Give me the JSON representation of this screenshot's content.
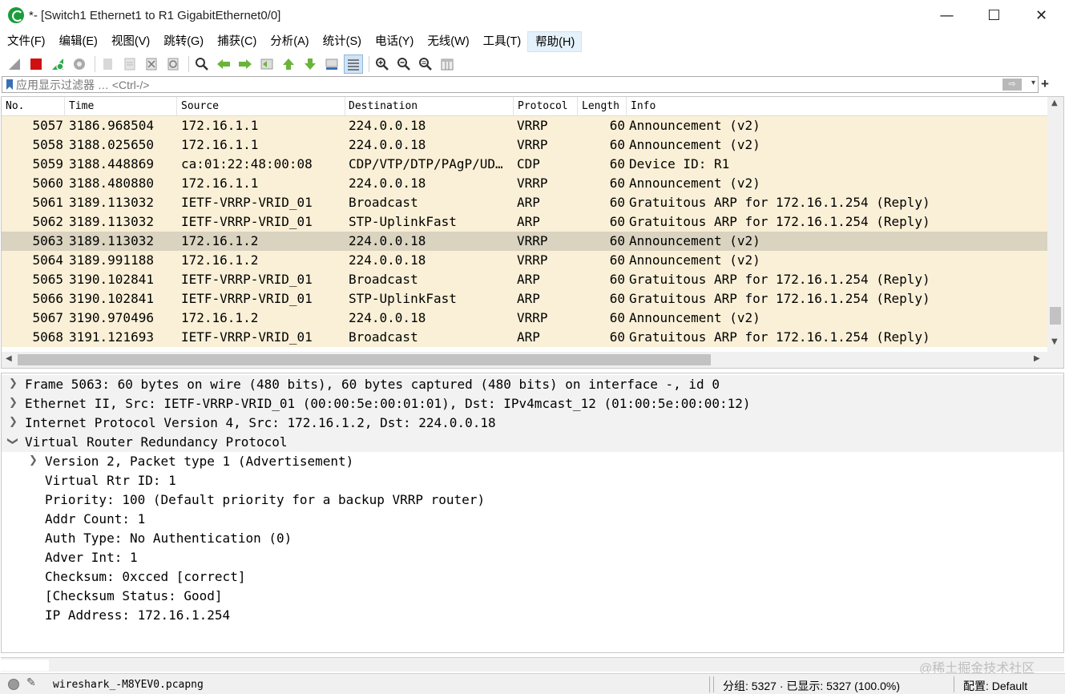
{
  "window": {
    "title": "*- [Switch1 Ethernet1 to R1 GigabitEthernet0/0]",
    "minimize": "—",
    "maximize": "☐",
    "close": "✕"
  },
  "menu": [
    "文件(F)",
    "编辑(E)",
    "视图(V)",
    "跳转(G)",
    "捕获(C)",
    "分析(A)",
    "统计(S)",
    "电话(Y)",
    "无线(W)",
    "工具(T)",
    "帮助(H)"
  ],
  "filter": {
    "placeholder": "应用显示过滤器 … <Ctrl-/>",
    "apply": "⇨",
    "dropdown": "▾",
    "add": "+"
  },
  "packet_list": {
    "columns": [
      "No.",
      "Time",
      "Source",
      "Destination",
      "Protocol",
      "Length",
      "Info"
    ],
    "rows": [
      [
        "5057",
        "3186.968504",
        "172.16.1.1",
        "224.0.0.18",
        "VRRP",
        "60",
        "Announcement (v2)"
      ],
      [
        "5058",
        "3188.025650",
        "172.16.1.1",
        "224.0.0.18",
        "VRRP",
        "60",
        "Announcement (v2)"
      ],
      [
        "5059",
        "3188.448869",
        "ca:01:22:48:00:08",
        "CDP/VTP/DTP/PAgP/UD…",
        "CDP",
        "60",
        "Device ID: R1"
      ],
      [
        "5060",
        "3188.480880",
        "172.16.1.1",
        "224.0.0.18",
        "VRRP",
        "60",
        "Announcement (v2)"
      ],
      [
        "5061",
        "3189.113032",
        "IETF-VRRP-VRID_01",
        "Broadcast",
        "ARP",
        "60",
        "Gratuitous ARP for 172.16.1.254 (Reply)"
      ],
      [
        "5062",
        "3189.113032",
        "IETF-VRRP-VRID_01",
        "STP-UplinkFast",
        "ARP",
        "60",
        "Gratuitous ARP for 172.16.1.254 (Reply)"
      ],
      [
        "5063",
        "3189.113032",
        "172.16.1.2",
        "224.0.0.18",
        "VRRP",
        "60",
        "Announcement (v2)"
      ],
      [
        "5064",
        "3189.991188",
        "172.16.1.2",
        "224.0.0.18",
        "VRRP",
        "60",
        "Announcement (v2)"
      ],
      [
        "5065",
        "3190.102841",
        "IETF-VRRP-VRID_01",
        "Broadcast",
        "ARP",
        "60",
        "Gratuitous ARP for 172.16.1.254 (Reply)"
      ],
      [
        "5066",
        "3190.102841",
        "IETF-VRRP-VRID_01",
        "STP-UplinkFast",
        "ARP",
        "60",
        "Gratuitous ARP for 172.16.1.254 (Reply)"
      ],
      [
        "5067",
        "3190.970496",
        "172.16.1.2",
        "224.0.0.18",
        "VRRP",
        "60",
        "Announcement (v2)"
      ],
      [
        "5068",
        "3191.121693",
        "IETF-VRRP-VRID_01",
        "Broadcast",
        "ARP",
        "60",
        "Gratuitous ARP for 172.16.1.254 (Reply)"
      ]
    ],
    "selected_no": "5063",
    "row_color": "#faf0d7",
    "selected_color": "#d9d3c0"
  },
  "details": {
    "frame": "Frame 5063: 60 bytes on wire (480 bits), 60 bytes captured (480 bits) on interface -, id 0",
    "ethernet": "Ethernet II, Src: IETF-VRRP-VRID_01 (00:00:5e:00:01:01), Dst: IPv4mcast_12 (01:00:5e:00:00:12)",
    "ip": "Internet Protocol Version 4, Src: 172.16.1.2, Dst: 224.0.0.18",
    "vrrp": "Virtual Router Redundancy Protocol",
    "version": "Version 2, Packet type 1 (Advertisement)",
    "vrid": "Virtual Rtr ID: 1",
    "priority": "Priority: 100 (Default priority for a backup VRRP router)",
    "addr_count": "Addr Count: 1",
    "auth_type": "Auth Type: No Authentication (0)",
    "adver_int": "Adver Int: 1",
    "checksum": "Checksum: 0xcced [correct]",
    "checksum_status": "[Checksum Status: Good]",
    "ip_address": "IP Address: 172.16.1.254"
  },
  "status": {
    "file": "wireshark_-M8YEV0.pcapng",
    "stats": "分组: 5327 · 已显示: 5327 (100.0%)",
    "profile": "配置: Default"
  },
  "watermark": "@稀土掘金技术社区"
}
